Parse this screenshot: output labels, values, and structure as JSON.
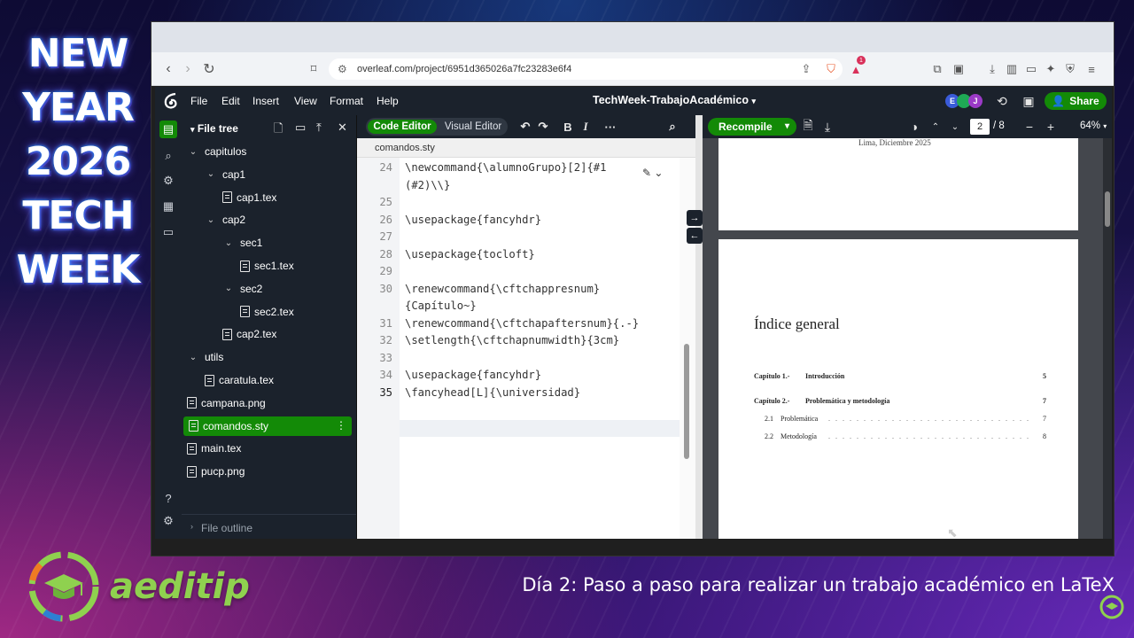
{
  "event": {
    "title_lines": [
      "NEW",
      "YEAR",
      "2026",
      "TECH",
      "WEEK"
    ]
  },
  "brand": {
    "name": "aeditip"
  },
  "caption": "Día 2: Paso a paso para realizar un trabajo académico en LaTeX",
  "browser": {
    "url": "overleaf.com/project/6951d365026a7fc23283e6f4",
    "notification_count": "1"
  },
  "app": {
    "menu": [
      "File",
      "Edit",
      "Insert",
      "View",
      "Format",
      "Help"
    ],
    "project_title": "TechWeek-TrabajoAcadémico",
    "avatars": [
      "E",
      "",
      "J"
    ],
    "share_label": "Share"
  },
  "filetree": {
    "title": "File tree",
    "items": [
      {
        "label": "capitulos",
        "type": "folder",
        "depth": 0
      },
      {
        "label": "cap1",
        "type": "folder",
        "depth": 1
      },
      {
        "label": "cap1.tex",
        "type": "file",
        "depth": 2
      },
      {
        "label": "cap2",
        "type": "folder",
        "depth": 1
      },
      {
        "label": "sec1",
        "type": "folder",
        "depth": 2
      },
      {
        "label": "sec1.tex",
        "type": "file",
        "depth": 3
      },
      {
        "label": "sec2",
        "type": "folder",
        "depth": 2
      },
      {
        "label": "sec2.tex",
        "type": "file",
        "depth": 3
      },
      {
        "label": "cap2.tex",
        "type": "file",
        "depth": 2
      },
      {
        "label": "utils",
        "type": "folder",
        "depth": 0
      },
      {
        "label": "caratula.tex",
        "type": "file",
        "depth": 1
      },
      {
        "label": "campana.png",
        "type": "file",
        "depth": 0
      },
      {
        "label": "comandos.sty",
        "type": "file",
        "depth": 0,
        "selected": true
      },
      {
        "label": "main.tex",
        "type": "file",
        "depth": 0
      },
      {
        "label": "pucp.png",
        "type": "file",
        "depth": 0
      }
    ],
    "outline_label": "File outline"
  },
  "editor": {
    "mode_code": "Code Editor",
    "mode_visual": "Visual Editor",
    "open_file": "comandos.sty",
    "lines": [
      {
        "num": "24",
        "text": "\\newcommand{\\alumnoGrupo}[2]{#1"
      },
      {
        "num": "",
        "text": "(#2)\\\\}"
      },
      {
        "num": "25",
        "text": ""
      },
      {
        "num": "26",
        "text": "\\usepackage{fancyhdr}"
      },
      {
        "num": "27",
        "text": ""
      },
      {
        "num": "28",
        "text": "\\usepackage{tocloft}"
      },
      {
        "num": "29",
        "text": ""
      },
      {
        "num": "30",
        "text": "\\renewcommand{\\cftchappresnum}"
      },
      {
        "num": "",
        "text": "{Capítulo~}"
      },
      {
        "num": "31",
        "text": "\\renewcommand{\\cftchapaftersnum}{.-}"
      },
      {
        "num": "32",
        "text": "\\setlength{\\cftchapnumwidth}{3cm}"
      },
      {
        "num": "33",
        "text": ""
      },
      {
        "num": "34",
        "text": "\\usepackage{fancyhdr}"
      },
      {
        "num": "35",
        "text": "\\fancyhead[L]{\\universidad}",
        "current": true
      }
    ]
  },
  "pdf": {
    "recompile_label": "Recompile",
    "page_current": "2",
    "page_total": "/ 8",
    "zoom": "64%",
    "page1_tail": "Lima, Diciembre 2025",
    "toc_title": "Índice general",
    "toc": [
      {
        "label": "Capítulo 1.-",
        "title": "Introducción",
        "page": "5",
        "level": 0
      },
      {
        "label": "Capítulo 2.-",
        "title": "Problemática y metodología",
        "page": "7",
        "level": 0
      },
      {
        "label": "2.1",
        "title": "Problemática",
        "page": "7",
        "level": 1
      },
      {
        "label": "2.2",
        "title": "Metodología",
        "page": "8",
        "level": 1
      }
    ]
  }
}
